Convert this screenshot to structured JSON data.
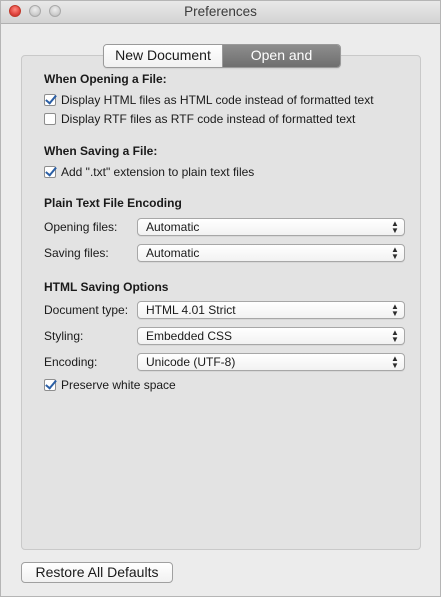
{
  "window": {
    "title": "Preferences"
  },
  "tabs": [
    {
      "label": "New Document",
      "selected": false
    },
    {
      "label": "Open and Save",
      "selected": true
    }
  ],
  "opening": {
    "heading": "When Opening a File:",
    "options": [
      {
        "label": "Display HTML files as HTML code instead of formatted text",
        "checked": true
      },
      {
        "label": "Display RTF files as RTF code instead of formatted text",
        "checked": false
      }
    ]
  },
  "saving": {
    "heading": "When Saving a File:",
    "options": [
      {
        "label": "Add \".txt\" extension to plain text files",
        "checked": true
      }
    ]
  },
  "encoding": {
    "heading": "Plain Text File Encoding",
    "opening_label": "Opening files:",
    "opening_value": "Automatic",
    "saving_label": "Saving files:",
    "saving_value": "Automatic"
  },
  "html": {
    "heading": "HTML Saving Options",
    "doctype_label": "Document type:",
    "doctype_value": "HTML 4.01 Strict",
    "styling_label": "Styling:",
    "styling_value": "Embedded CSS",
    "encoding_label": "Encoding:",
    "encoding_value": "Unicode (UTF-8)",
    "preserve_label": "Preserve white space",
    "preserve_checked": true
  },
  "footer": {
    "restore_label": "Restore All Defaults"
  }
}
